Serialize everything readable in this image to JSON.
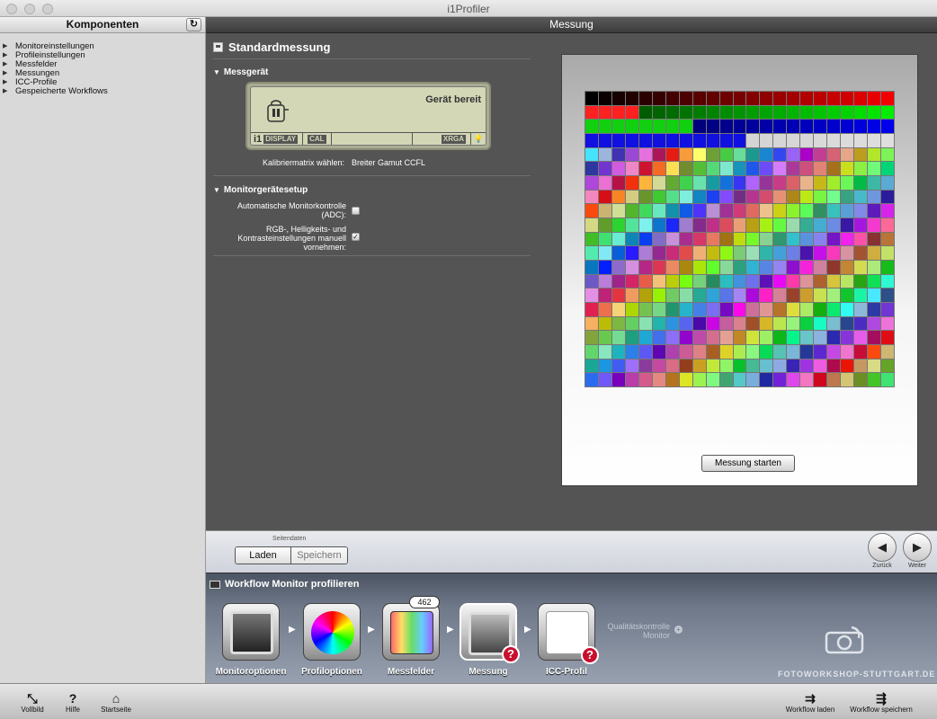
{
  "window": {
    "title": "i1Profiler"
  },
  "left": {
    "header": "Komponenten",
    "items": [
      "Monitoreinstellungen",
      "Profileinstellungen",
      "Messfelder",
      "Messungen",
      "ICC-Profile",
      "Gespeicherte Workflows"
    ]
  },
  "main": {
    "header": "Messung",
    "title": "Standardmessung",
    "device": {
      "section": "Messgerät",
      "status": "Gerät bereit",
      "brand": "i1",
      "model": "DISPLAY",
      "mode": "CAL",
      "signal": "XRGA",
      "calib_label": "Kalibriermatrix wählen:",
      "calib_value": "Breiter Gamut CCFL"
    },
    "setup": {
      "section": "Monitorgerätesetup",
      "adc_label": "Automatische Monitorkontrolle (ADC):",
      "adc_checked": false,
      "manual_label": "RGB-, Helligkeits- und Kontrasteinstellungen manuell vornehmen:",
      "manual_checked": true
    },
    "start_button": "Messung starten"
  },
  "nav": {
    "group_label": "Seitendaten",
    "load": "Laden",
    "save": "Speichern",
    "back": "Zurück",
    "next": "Weiter"
  },
  "workflow": {
    "title": "Workflow Monitor profilieren",
    "steps": [
      "Monitoroptionen",
      "Profiloptionen",
      "Messfelder",
      "Messung",
      "ICC-Profil"
    ],
    "patch_count": "462",
    "qc_label": "Qualitätskontrolle Monitor",
    "logo": "FOTOWORKSHOP-STUTTGART.DE"
  },
  "toolbar": {
    "fullscreen": "Vollbild",
    "help": "Hilfe",
    "home": "Startseite",
    "load_workflow": "Workflow laden",
    "save_workflow": "Workflow speichern"
  }
}
